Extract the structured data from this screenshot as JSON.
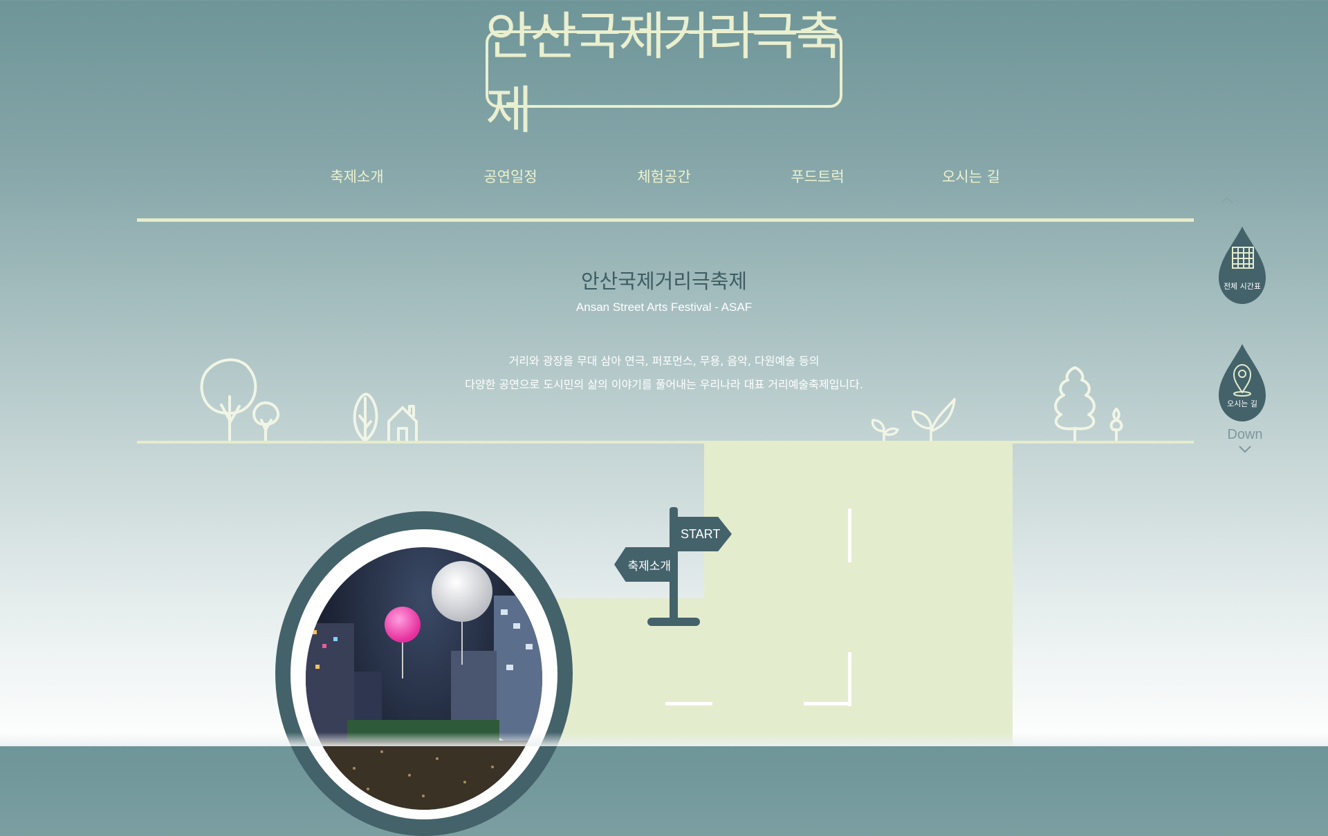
{
  "logo": {
    "text": "안산국제거리극축제"
  },
  "nav": {
    "items": [
      {
        "label": "축제소개"
      },
      {
        "label": "공연일정"
      },
      {
        "label": "체험공간"
      },
      {
        "label": "푸드트럭"
      },
      {
        "label": "오시는 길"
      }
    ]
  },
  "intro": {
    "title": "안산국제거리극축제",
    "subtitle": "Ansan Street Arts Festival - ASAF",
    "desc_line1": "거리와 광장을 무대 삼아 연극, 퍼포먼스, 무용, 음악, 다원예술 등의",
    "desc_line2": "다양한 공연으로 도시민의 삶의 이야기를 풀어내는 우리나라 대표 거리예술축제입니다."
  },
  "signpost": {
    "start_label": "START",
    "section_label": "축제소개"
  },
  "side": {
    "timetable_label": "전체 시간표",
    "directions_label": "오시는 길",
    "down_label": "Down"
  },
  "colors": {
    "accent": "#e6ecc8",
    "dark": "#44626a",
    "title": "#3d5d63"
  }
}
